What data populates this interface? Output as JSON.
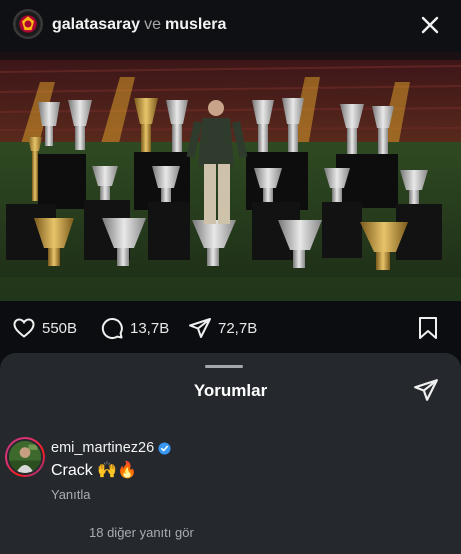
{
  "header": {
    "account": "galatasaray",
    "conjunction": "ve",
    "collaborator": "muslera",
    "close_icon": "close-icon"
  },
  "post": {
    "image_icon": "trophy-photo"
  },
  "actions": {
    "likes": "550B",
    "comments": "13,7B",
    "shares": "72,7B",
    "like_icon": "heart-icon",
    "comment_icon": "comment-icon",
    "share_icon": "send-icon",
    "save_icon": "bookmark-icon"
  },
  "comments_sheet": {
    "title": "Yorumlar",
    "send_icon": "send-icon"
  },
  "comment": {
    "username": "emi_martinez26",
    "verified_icon": "verified-badge-icon",
    "text": "Crack 🙌🔥",
    "reply_label": "Yanıtla",
    "view_replies": "18 diğer yanıtı gör"
  },
  "colors": {
    "background": "#0b0d10",
    "sheet": "#25292e",
    "verified": "#3897f0",
    "muted_text": "#a9adb1"
  }
}
